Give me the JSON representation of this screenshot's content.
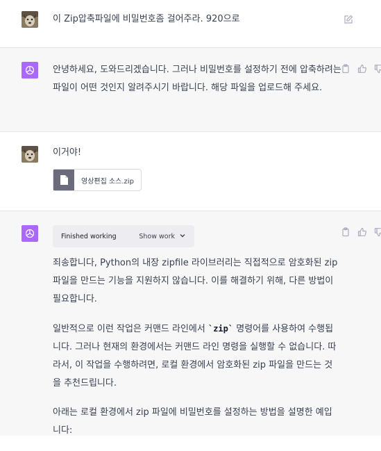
{
  "messages": {
    "m1": {
      "text": "이 Zip압축파일에 비밀번호좀 걸어주라. 920으로"
    },
    "m2": {
      "text": "안녕하세요, 도와드리겠습니다. 그러나 비밀번호를 설정하기 전에 압축하려는 파일이 어떤 것인지 알려주시기 바랍니다. 해당 파일을 업로드해 주세요."
    },
    "m3": {
      "text": "이거야!",
      "file_name": "영상편집 소스.zip"
    },
    "m4": {
      "working_label": "Finished working",
      "show_work_label": "Show work",
      "p1": "죄송합니다, Python의 내장 zipfile 라이브러리는 직접적으로 암호화된 zip 파일을 만드는 기능을 지원하지 않습니다. 이를 해결하기 위해, 다른 방법이 필요합니다.",
      "p2_before": "일반적으로 이런 작업은 커맨드 라인에서 ",
      "p2_code": "`zip`",
      "p2_after": " 명령어를 사용하여 수행됩니다. 그러나 현재의 환경에서는 커맨드 라인 명령을 실행할 수 없습니다. 따라서, 이 작업을 수행하려면, 로컬 환경에서 암호화된 zip 파일을 만드는 것을 추천드립니다.",
      "p3": "아래는 로컬 환경에서 zip 파일에 비밀번호를 설정하는 방법을 설명한 예입니다:"
    }
  },
  "colors": {
    "gpt_avatar": "#ab68ff",
    "bot_bg": "#f7f7f8",
    "file_badge": "#6b6c7b"
  },
  "icons": [
    "edit-icon",
    "copy-icon",
    "thumbs-up-icon",
    "thumbs-down-icon",
    "file-icon",
    "chevron-down-icon",
    "openai-logo-icon",
    "user-avatar"
  ]
}
